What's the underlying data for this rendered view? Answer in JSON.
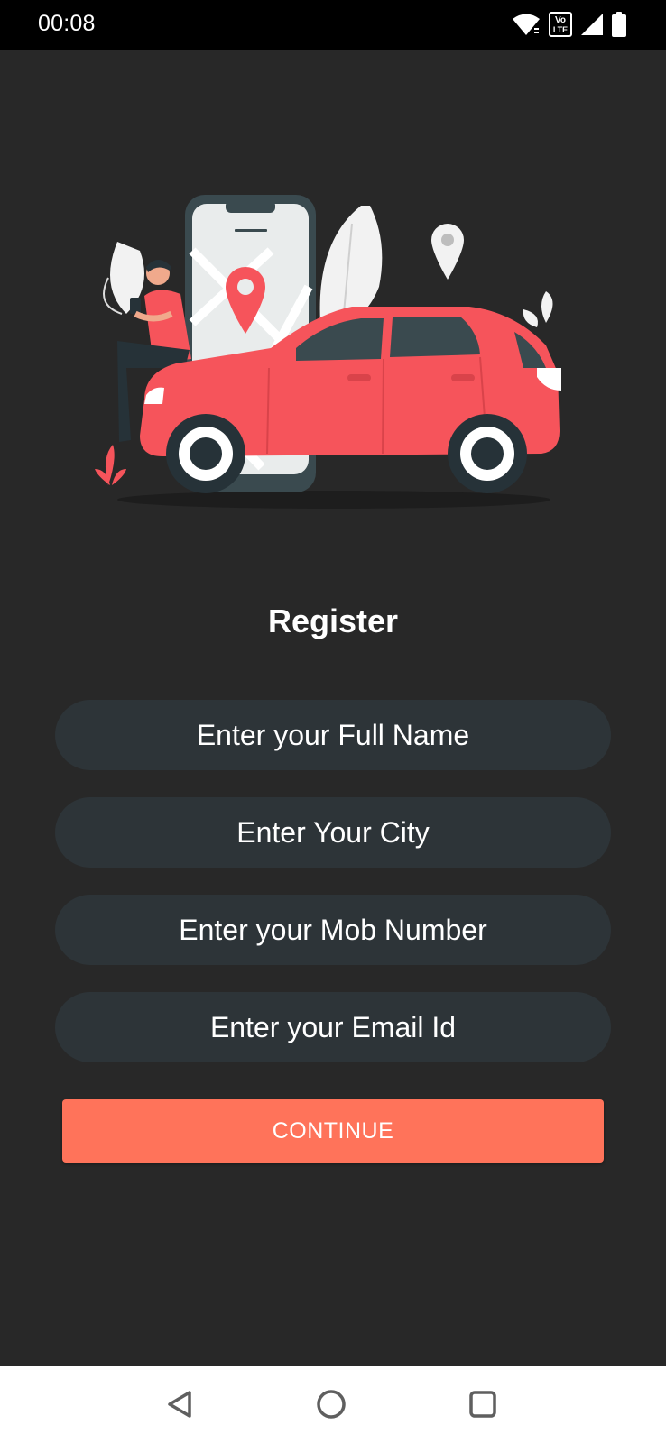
{
  "status_bar": {
    "time": "00:08",
    "icons": [
      "wifi-icon",
      "volte-icon",
      "signal-icon",
      "battery-icon"
    ],
    "volte_text_top": "Vo",
    "volte_text_bottom": "LTE"
  },
  "illustration": {
    "icon": "car-booking-illustration",
    "colors": {
      "car": "#f6545b",
      "phone": "#3a4a4f",
      "accent": "#ff735a"
    }
  },
  "register": {
    "title": "Register",
    "fields": [
      {
        "placeholder": "Enter your Full Name",
        "value": ""
      },
      {
        "placeholder": "Enter Your City",
        "value": ""
      },
      {
        "placeholder": "Enter your Mob Number",
        "value": ""
      },
      {
        "placeholder": "Enter your Email Id",
        "value": ""
      }
    ],
    "continue_label": "CONTINUE"
  },
  "nav_bar": {
    "buttons": [
      "back-icon",
      "home-icon",
      "recents-icon"
    ]
  },
  "colors": {
    "background": "#282828",
    "field_background": "#2d3438",
    "button": "#ff735a",
    "status_bar": "#000000",
    "nav_bar": "#ffffff"
  }
}
